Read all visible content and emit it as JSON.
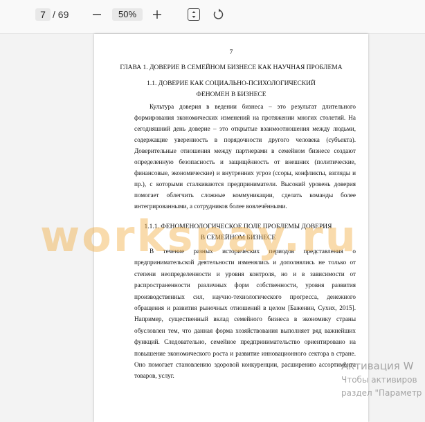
{
  "toolbar": {
    "current_page": "7",
    "total_pages": "/ 69",
    "zoom_level": "50%",
    "icons": [
      "minus-icon",
      "plus-icon",
      "fit-page-icon",
      "rotate-icon"
    ]
  },
  "page": {
    "number": "7",
    "chapter_title": "ГЛАВА 1. ДОВЕРИЕ В СЕМЕЙНОМ БИЗНЕСЕ КАК НАУЧНАЯ ПРОБЛЕМА",
    "section_title": "1.1. ДОВЕРИЕ КАК СОЦИАЛЬНО-ПСИХОЛОГИЧЕСКИЙ ФЕНОМЕН В БИЗНЕСЕ",
    "paragraph1": "Культура доверия в ведении бизнеса – это результат длительного формирования экономических изменений на протяжении многих столетий. На сегодняшний день доверие – это открытые взаимоотношения между людьми, содержащие уверенность в порядочности другого человека (субъекта). Доверительные отношения между партнерами в семейном бизнесе создают определенную безопасность и защищённость от внешних (политические, финансовые, экономические) и внутренних угроз (ссоры, конфликты, взгляды и пр.), с которыми сталкиваются предприниматели. Высокий уровень доверия помогает облегчить сложные коммуникации, сделать команды более интегрированными, а сотрудников более вовлечёнными.",
    "subsection_title": "1.1.1. ФЕНОМЕНОЛОГИЧЕСКОЕ ПОЛЕ ПРОБЛЕМЫ ДОВЕРИЯ В СЕМЕЙНОМ БИЗНЕСЕ",
    "paragraph2": "В течение разных исторических периодов представления о предпринимательской деятельности изменялись и дополнялись не только от степени неопределенности и уровня контроля, но и в зависимости от распространенности различных форм собственности, уровня развития производственных сил, научно-технологического прогресса, денежного обращения и развития рыночных отношений в целом [Баженин, Сухих, 2015]. Например, существенный вклад семейного бизнеса в экономику страны обусловлен тем, что данная форма хозяйствования выполняет ряд важнейших функций. Следовательно, семейное предпринимательство ориентировано на повышение экономического роста и развитие инновационного сектора в стране. Оно помогает становлению здоровой конкуренции, расширению ассортимента товаров, услуг."
  },
  "watermark": "workspay.ru",
  "activation": {
    "title": "Активация W",
    "line1": "Чтобы активиров",
    "line2": "раздел \"Параметр"
  }
}
